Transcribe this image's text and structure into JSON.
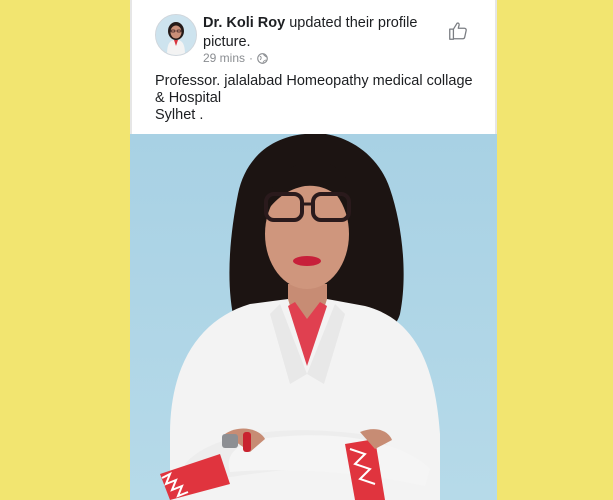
{
  "post": {
    "author": "Dr. Koli Roy",
    "action": "updated their profile picture.",
    "timestamp": "29 mins",
    "separator": "·",
    "privacy_icon": "globe-icon",
    "like_icon": "thumbs-up-icon",
    "text_lines": [
      "Professor. jalalabad Homeopathy medical collage",
      "& Hospital",
      "Sylhet ."
    ]
  },
  "colors": {
    "page_background": "#f2e570",
    "photo_background": "#a9d3e6",
    "coat": "#f4f4f4",
    "trim": "#e0343e"
  }
}
